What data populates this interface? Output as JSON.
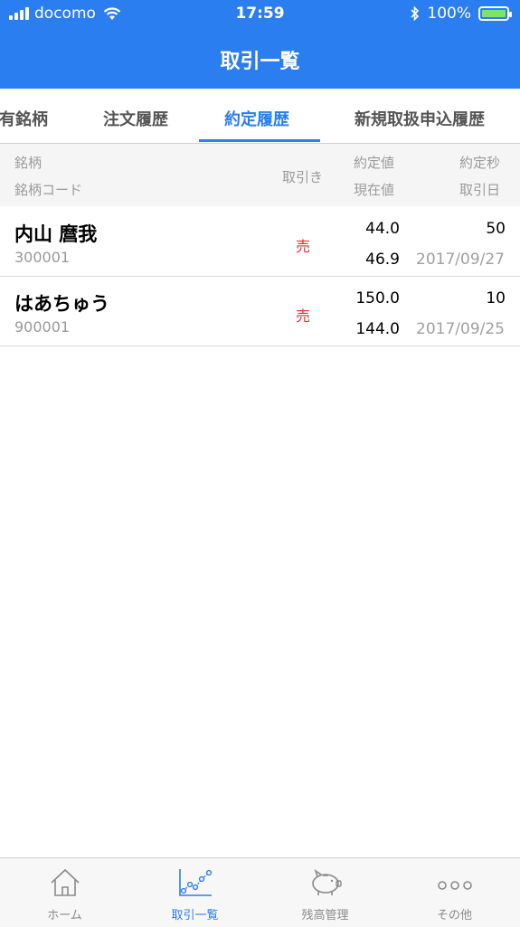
{
  "status": {
    "carrier": "docomo",
    "time": "17:59",
    "battery": "100%"
  },
  "nav": {
    "title": "取引一覧"
  },
  "tabs": [
    {
      "label": "有銘柄"
    },
    {
      "label": "注文履歴"
    },
    {
      "label": "約定履歴"
    },
    {
      "label": "新規取扱申込履歴"
    }
  ],
  "header": {
    "stock": "銘柄",
    "stock_code": "銘柄コード",
    "trade": "取引き",
    "exec_price": "約定値",
    "current_price": "現在値",
    "exec_qty": "約定秒",
    "trade_date": "取引日"
  },
  "rows": [
    {
      "name": "内山 麿我",
      "code": "300001",
      "side": "売",
      "exec_price": "44.0",
      "current_price": "46.9",
      "qty": "50",
      "date": "2017/09/27"
    },
    {
      "name": "はあちゅう",
      "code": "900001",
      "side": "売",
      "exec_price": "150.0",
      "current_price": "144.0",
      "qty": "10",
      "date": "2017/09/25"
    }
  ],
  "tabbar": [
    {
      "label": "ホーム",
      "icon": "home-icon"
    },
    {
      "label": "取引一覧",
      "icon": "chart-icon"
    },
    {
      "label": "残高管理",
      "icon": "piggy-bank-icon"
    },
    {
      "label": "その他",
      "icon": "more-icon"
    }
  ],
  "colors": {
    "accent": "#2a7ef0",
    "sell": "#e0333a"
  }
}
